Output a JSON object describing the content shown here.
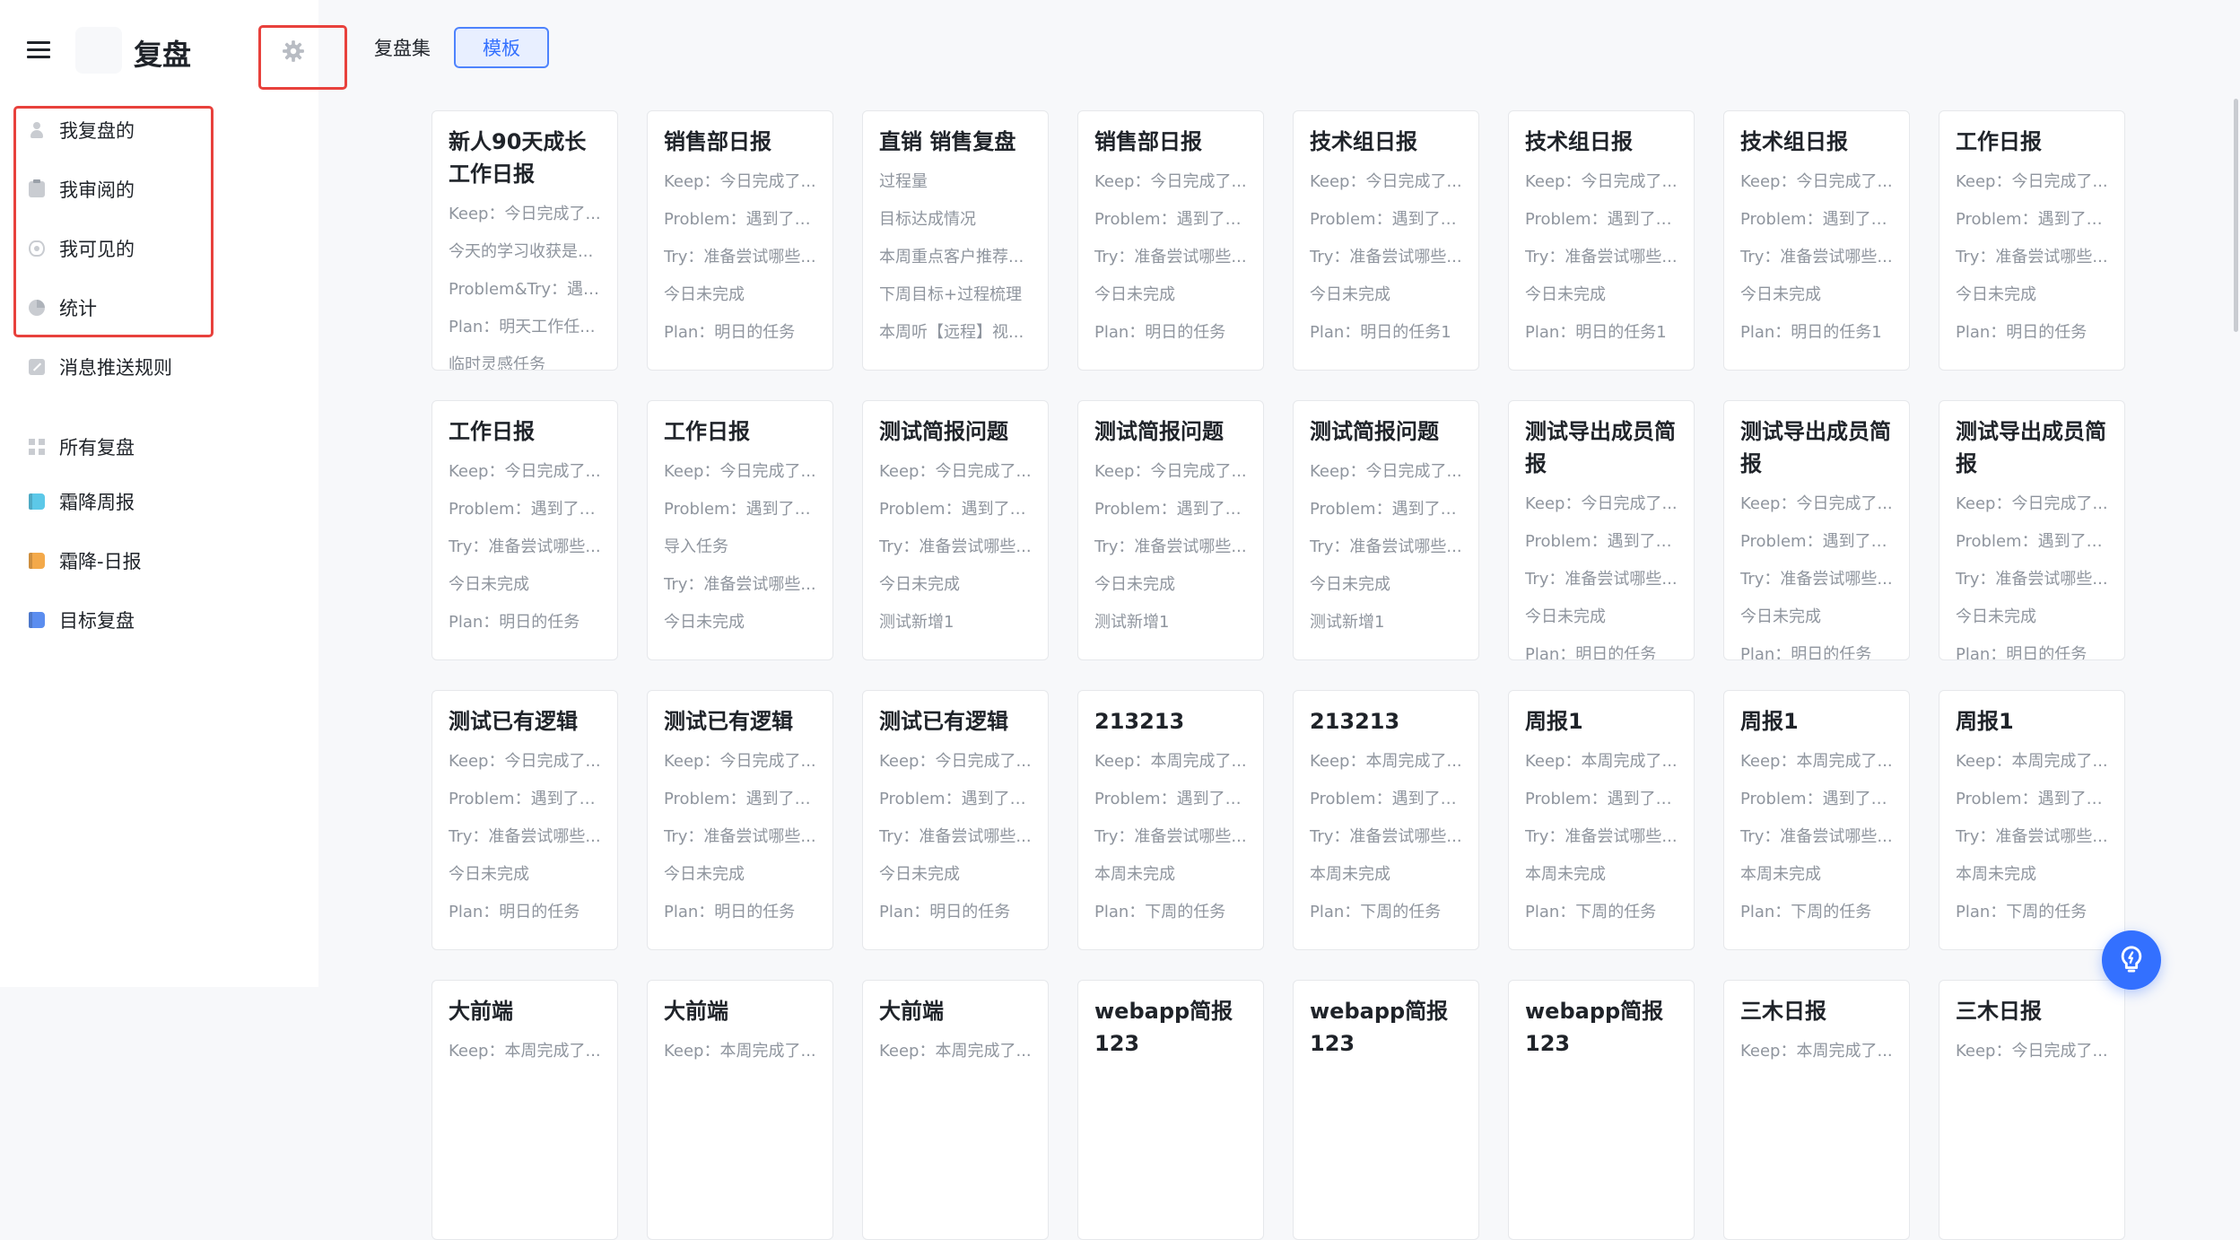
{
  "app": {
    "title": "复盘"
  },
  "sidebar": {
    "items": [
      {
        "label": "我复盘的",
        "icon": "person-icon"
      },
      {
        "label": "我审阅的",
        "icon": "clipboard-icon"
      },
      {
        "label": "我可见的",
        "icon": "eye-icon"
      },
      {
        "label": "统计",
        "icon": "pie-chart-icon"
      },
      {
        "label": "消息推送规则",
        "icon": "edit-icon"
      }
    ],
    "collections": [
      {
        "label": "所有复盘",
        "icon": "grid-icon"
      },
      {
        "label": "霜降周报",
        "icon": "book-icon",
        "color": "#5cc8e8"
      },
      {
        "label": "霜降-日报",
        "icon": "book-icon",
        "color": "#f3a94a"
      },
      {
        "label": "目标复盘",
        "icon": "book-icon",
        "color": "#5b8def"
      }
    ]
  },
  "tabs": [
    {
      "label": "复盘集",
      "active": false
    },
    {
      "label": "模板",
      "active": true
    }
  ],
  "colors": {
    "accent": "#3370ff",
    "highlight": "#e8413c",
    "muted_text": "#8f959e"
  },
  "cards": [
    {
      "title": "新人90天成长工作日报",
      "lines": [
        "Keep：今日完成了...",
        "今天的学习收获是...",
        "Problem&Try：遇到...",
        "Plan：明天工作任...",
        "临时灵感任务"
      ]
    },
    {
      "title": "销售部日报",
      "lines": [
        "Keep：今日完成了...",
        "Problem：遇到了什...",
        "Try：准备尝试哪些...",
        "今日未完成",
        "Plan：明日的任务"
      ]
    },
    {
      "title": "直销 销售复盘",
      "lines": [
        "过程量",
        "目标达成情况",
        "本周重点客户推荐...",
        "下周目标+过程梳理",
        "本周听【远程】视..."
      ]
    },
    {
      "title": "销售部日报",
      "lines": [
        "Keep：今日完成了...",
        "Problem：遇到了什...",
        "Try：准备尝试哪些...",
        "今日未完成",
        "Plan：明日的任务"
      ]
    },
    {
      "title": "技术组日报",
      "lines": [
        "Keep：今日完成了...",
        "Problem：遇到了什...",
        "Try：准备尝试哪些...",
        "今日未完成",
        "Plan：明日的任务1"
      ]
    },
    {
      "title": "技术组日报",
      "lines": [
        "Keep：今日完成了...",
        "Problem：遇到了什...",
        "Try：准备尝试哪些...",
        "今日未完成",
        "Plan：明日的任务1"
      ]
    },
    {
      "title": "技术组日报",
      "lines": [
        "Keep：今日完成了...",
        "Problem：遇到了什...",
        "Try：准备尝试哪些...",
        "今日未完成",
        "Plan：明日的任务1"
      ]
    },
    {
      "title": "工作日报",
      "lines": [
        "Keep：今日完成了...",
        "Problem：遇到了什...",
        "Try：准备尝试哪些...",
        "今日未完成",
        "Plan：明日的任务"
      ]
    },
    {
      "title": "工作日报",
      "lines": [
        "Keep：今日完成了...",
        "Problem：遇到了什...",
        "Try：准备尝试哪些...",
        "今日未完成",
        "Plan：明日的任务"
      ]
    },
    {
      "title": "工作日报",
      "lines": [
        "Keep：今日完成了...",
        "Problem：遇到了什...",
        "导入任务",
        "Try：准备尝试哪些...",
        "今日未完成"
      ]
    },
    {
      "title": "测试简报问题",
      "lines": [
        "Keep：今日完成了...",
        "Problem：遇到了什...",
        "Try：准备尝试哪些...",
        "今日未完成",
        "测试新增1"
      ]
    },
    {
      "title": "测试简报问题",
      "lines": [
        "Keep：今日完成了...",
        "Problem：遇到了什...",
        "Try：准备尝试哪些...",
        "今日未完成",
        "测试新增1"
      ]
    },
    {
      "title": "测试简报问题",
      "lines": [
        "Keep：今日完成了...",
        "Problem：遇到了什...",
        "Try：准备尝试哪些...",
        "今日未完成",
        "测试新增1"
      ]
    },
    {
      "title": "测试导出成员简报",
      "lines": [
        "Keep：今日完成了...",
        "Problem：遇到了什...",
        "Try：准备尝试哪些...",
        "今日未完成",
        "Plan：明日的任务"
      ]
    },
    {
      "title": "测试导出成员简报",
      "lines": [
        "Keep：今日完成了...",
        "Problem：遇到了什...",
        "Try：准备尝试哪些...",
        "今日未完成",
        "Plan：明日的任务"
      ]
    },
    {
      "title": "测试导出成员简报",
      "lines": [
        "Keep：今日完成了...",
        "Problem：遇到了什...",
        "Try：准备尝试哪些...",
        "今日未完成",
        "Plan：明日的任务"
      ]
    },
    {
      "title": "测试已有逻辑",
      "lines": [
        "Keep：今日完成了...",
        "Problem：遇到了什...",
        "Try：准备尝试哪些...",
        "今日未完成",
        "Plan：明日的任务"
      ]
    },
    {
      "title": "测试已有逻辑",
      "lines": [
        "Keep：今日完成了...",
        "Problem：遇到了什...",
        "Try：准备尝试哪些...",
        "今日未完成",
        "Plan：明日的任务"
      ]
    },
    {
      "title": "测试已有逻辑",
      "lines": [
        "Keep：今日完成了...",
        "Problem：遇到了什...",
        "Try：准备尝试哪些...",
        "今日未完成",
        "Plan：明日的任务"
      ]
    },
    {
      "title": "213213",
      "lines": [
        "Keep：本周完成了...",
        "Problem：遇到了什...",
        "Try：准备尝试哪些...",
        "本周未完成",
        "Plan：下周的任务"
      ]
    },
    {
      "title": "213213",
      "lines": [
        "Keep：本周完成了...",
        "Problem：遇到了什...",
        "Try：准备尝试哪些...",
        "本周未完成",
        "Plan：下周的任务"
      ]
    },
    {
      "title": "周报1",
      "lines": [
        "Keep：本周完成了...",
        "Problem：遇到了什...",
        "Try：准备尝试哪些...",
        "本周未完成",
        "Plan：下周的任务"
      ]
    },
    {
      "title": "周报1",
      "lines": [
        "Keep：本周完成了...",
        "Problem：遇到了什...",
        "Try：准备尝试哪些...",
        "本周未完成",
        "Plan：下周的任务"
      ]
    },
    {
      "title": "周报1",
      "lines": [
        "Keep：本周完成了...",
        "Problem：遇到了什...",
        "Try：准备尝试哪些...",
        "本周未完成",
        "Plan：下周的任务"
      ]
    },
    {
      "title": "大前端",
      "lines": [
        "Keep：本周完成了..."
      ]
    },
    {
      "title": "大前端",
      "lines": [
        "Keep：本周完成了..."
      ]
    },
    {
      "title": "大前端",
      "lines": [
        "Keep：本周完成了..."
      ]
    },
    {
      "title": "webapp简报123",
      "lines": []
    },
    {
      "title": "webapp简报123",
      "lines": []
    },
    {
      "title": "webapp简报123",
      "lines": []
    },
    {
      "title": "三木日报",
      "lines": [
        "Keep：本周完成了..."
      ]
    },
    {
      "title": "三木日报",
      "lines": [
        "Keep：今日完成了..."
      ]
    }
  ]
}
